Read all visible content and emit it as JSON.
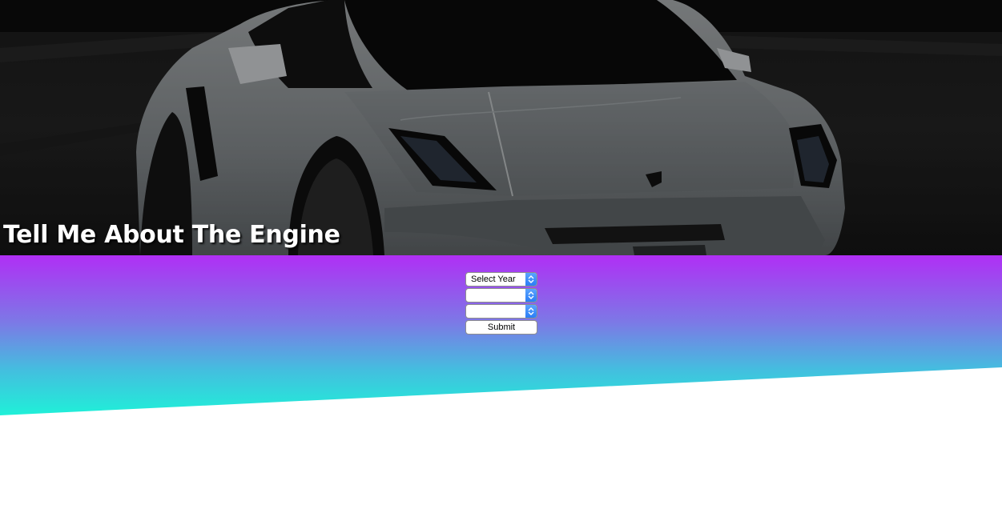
{
  "hero": {
    "title": "Tell Me About The Engine",
    "image_icon": "car-photo"
  },
  "colors": {
    "gradient_top": "#b02ff5",
    "gradient_mid": "#7c79e6",
    "gradient_bottom": "#1ff0d8",
    "select_arrow": "#2b7df6"
  },
  "form": {
    "year_select": {
      "selected": "Select Year",
      "icon": "select-stepper-icon"
    },
    "second_select": {
      "selected": "",
      "icon": "select-stepper-icon"
    },
    "third_select": {
      "selected": "",
      "icon": "select-stepper-icon"
    },
    "submit_label": "Submit"
  }
}
